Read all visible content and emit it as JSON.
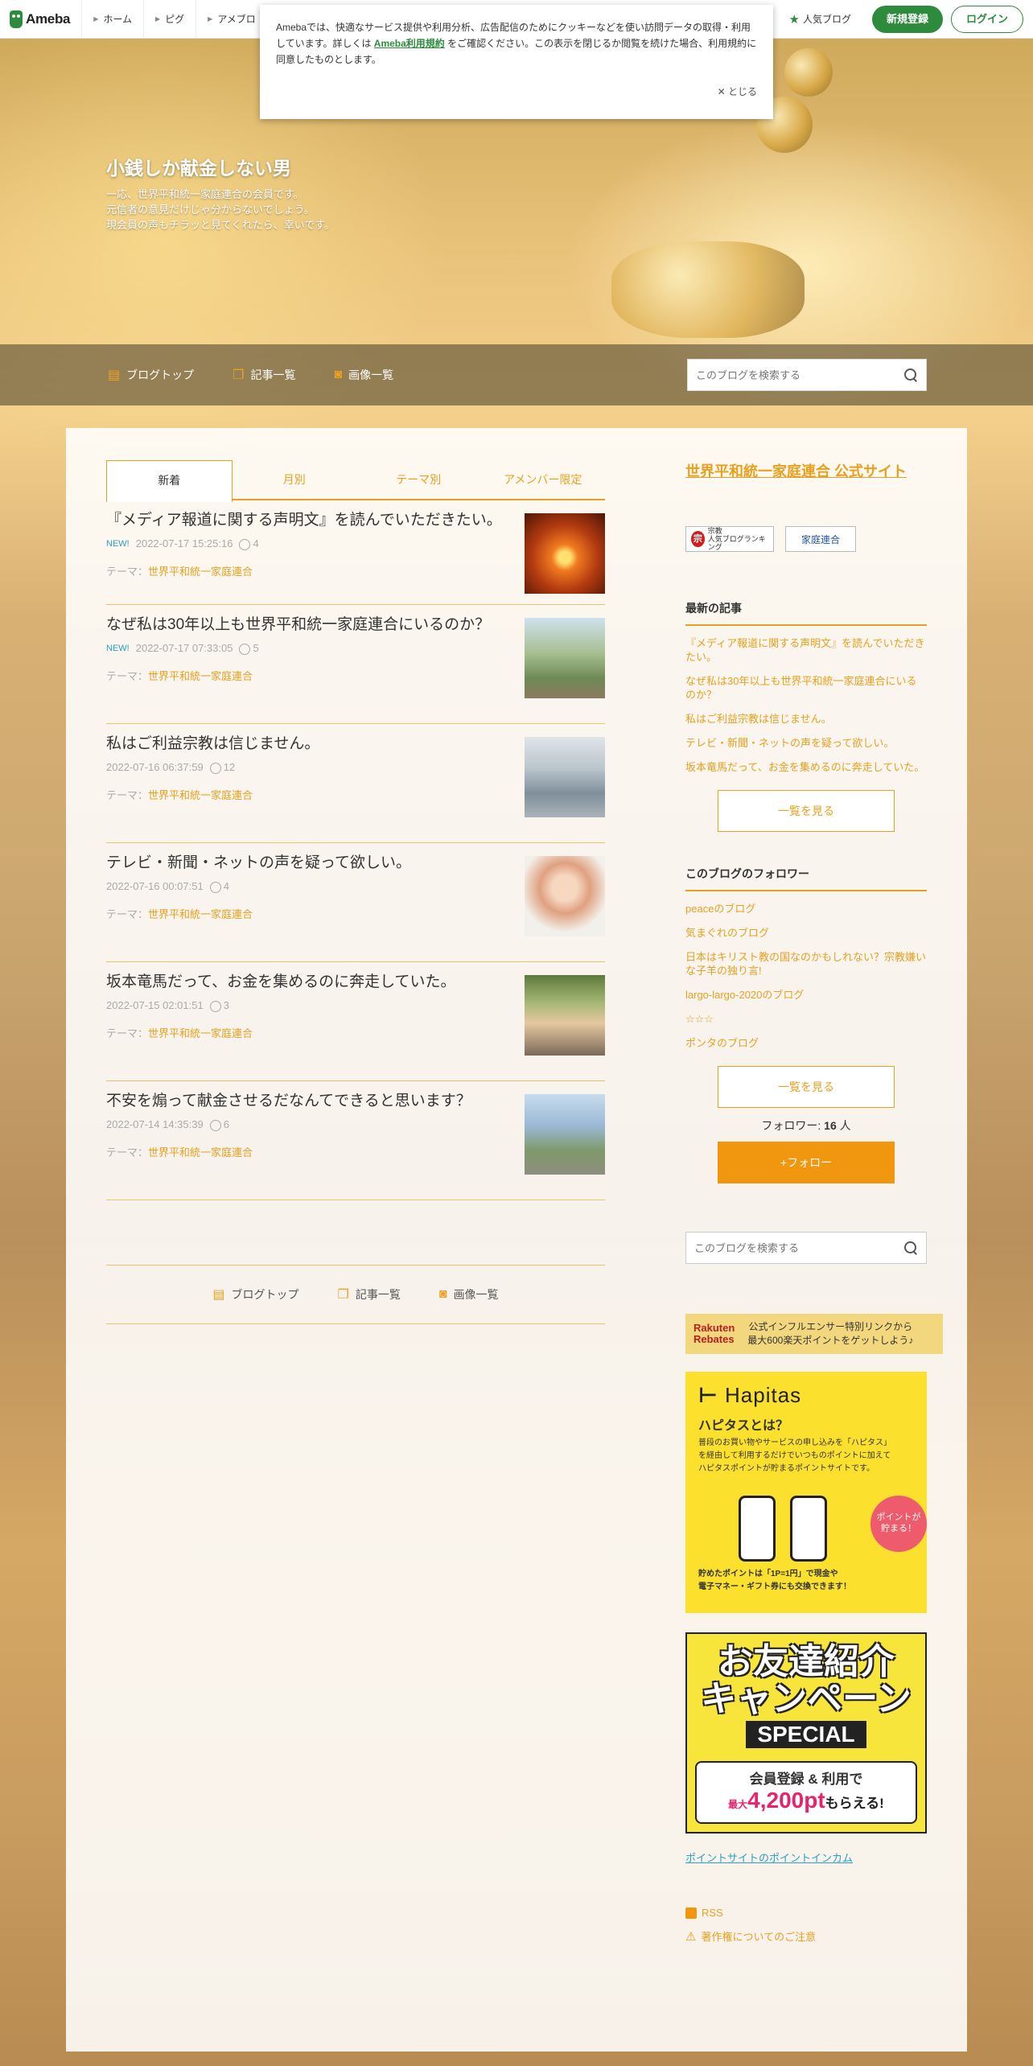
{
  "topbar": {
    "logo": "Ameba",
    "nav": [
      "ホーム",
      "ピグ",
      "アメブロ"
    ],
    "popular": "人気ブログ",
    "signup": "新規登録",
    "login": "ログイン"
  },
  "cookie": {
    "text_before": "Amebaでは、快適なサービス提供や利用分析、広告配信のためにクッキーなどを使い訪問データの取得・利用しています。詳しくは",
    "link": "Ameba利用規約",
    "text_after": "をご確認ください。この表示を閉じるか閲覧を続けた場合、利用規約に同意したものとします。",
    "close": "とじる"
  },
  "header": {
    "title": "小銭しか献金しない男",
    "description": "一応、世界平和統一家庭連合の会員です。\n元信者の意見だけじゃ分からないでしょう。\n現会員の声もチラッと見てくれたら、幸いです。"
  },
  "blognav": {
    "top": "ブログトップ",
    "list": "記事一覧",
    "images": "画像一覧",
    "search_placeholder": "このブログを検索する"
  },
  "tabs": [
    "新着",
    "月別",
    "テーマ別",
    "アメンバー限定"
  ],
  "theme_prefix": "テーマ：",
  "articles": [
    {
      "title": "『メディア報道に関する声明文』を読んでいただきたい。",
      "new": "NEW!",
      "date": "2022-07-17 15:25:16",
      "comments": "4",
      "theme": "世界平和統一家庭連合"
    },
    {
      "title": "なぜ私は30年以上も世界平和統一家庭連合にいるのか？",
      "new": "NEW!",
      "date": "2022-07-17 07:33:05",
      "comments": "5",
      "theme": "世界平和統一家庭連合"
    },
    {
      "title": "私はご利益宗教は信じません。",
      "new": "",
      "date": "2022-07-16 06:37:59",
      "comments": "12",
      "theme": "世界平和統一家庭連合"
    },
    {
      "title": "テレビ・新聞・ネットの声を疑って欲しい。",
      "new": "",
      "date": "2022-07-16 00:07:51",
      "comments": "4",
      "theme": "世界平和統一家庭連合"
    },
    {
      "title": "坂本竜馬だって、お金を集めるのに奔走していた。",
      "new": "",
      "date": "2022-07-15 02:01:51",
      "comments": "3",
      "theme": "世界平和統一家庭連合"
    },
    {
      "title": "不安を煽って献金させるだなんてできると思います？",
      "new": "",
      "date": "2022-07-14 14:35:39",
      "comments": "6",
      "theme": "世界平和統一家庭連合"
    }
  ],
  "side": {
    "official": "世界平和統一家庭連合 公式サイト",
    "badge1": "宗教\n人気ブログランキング",
    "badge1_mark": "宗",
    "badge2": "家庭連合",
    "recent_heading": "最新の記事",
    "recent": [
      "『メディア報道に関する声明文』を読んでいただきたい。",
      "なぜ私は30年以上も世界平和統一家庭連合にいるのか？",
      "私はご利益宗教は信じません。",
      "テレビ・新聞・ネットの声を疑って欲しい。",
      "坂本竜馬だって、お金を集めるのに奔走していた。"
    ],
    "more": "一覧を見る",
    "followers_heading": "このブログのフォロワー",
    "followers": [
      "peaceのブログ",
      "気まぐれのブログ",
      "日本はキリスト教の国なのかもしれない？宗教嫌いな子羊の独り言!",
      "largo-largo-2020のブログ",
      "☆☆☆",
      "ポンタのブログ"
    ],
    "follower_label": "フォロワー: ",
    "follower_count": "16",
    "follower_unit": " 人",
    "follow_button": "+フォロー",
    "search_placeholder": "このブログを検索する",
    "rakuten_logo": "Rakuten\nRebates",
    "rakuten_text": "公式インフルエンサー特別リンクから\n最大600楽天ポイントをゲットしよう♪",
    "hapitas_logo": "Hapitas",
    "hapitas_q": "ハピタスとは？",
    "hapitas_body": "普段のお買い物やサービスの申し込みを「ハピタス」\nを経由して利用するだけでいつものポイントに加えて\nハピタスポイントが貯まるポイントサイトです。",
    "hapitas_point": "ポイントが\n貯まる！",
    "hapitas_foot": "貯めたポイントは「1P=1円」で現金や\n電子マネー・ギフト券にも交換できます！",
    "friend_title": "お友達紹介\nキャンペーン",
    "friend_special": "SPECIAL",
    "friend_line1": "会員登録 & 利用で",
    "friend_max": "最大",
    "friend_pt": "4,200pt",
    "friend_tail": "もらえる!",
    "pointincome": "ポイントサイトのポイントインカム",
    "rss": "RSS",
    "copyright": "著作権についてのご注意"
  }
}
